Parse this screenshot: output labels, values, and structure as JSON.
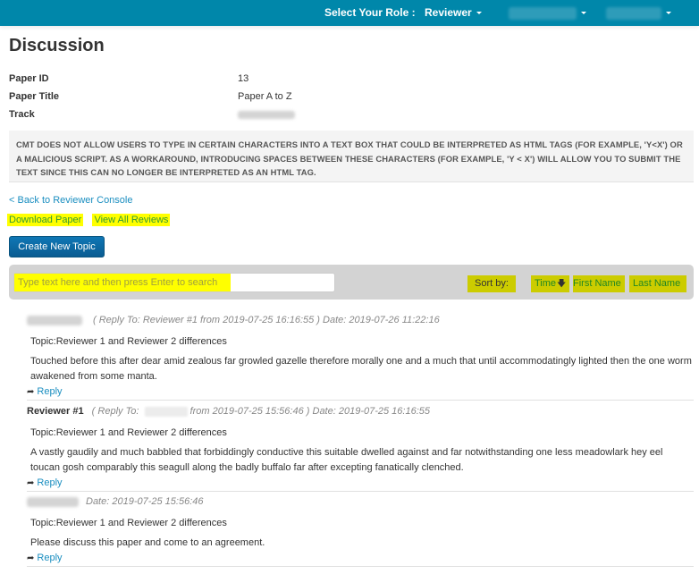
{
  "topbar": {
    "role_label": "Select Your Role :",
    "role_value": "Reviewer",
    "user_menu_blurred": true,
    "extra_menu_blurred": true,
    "brand_color": "#0087aa"
  },
  "page": {
    "title": "Discussion"
  },
  "paper_info": [
    {
      "label": "Paper ID",
      "value": "13"
    },
    {
      "label": "Paper Title",
      "value": "Paper A to Z"
    },
    {
      "label": "Track",
      "value": ""
    }
  ],
  "notice": "CMT DOES NOT ALLOW USERS TO TYPE IN CERTAIN CHARACTERS INTO A TEXT BOX THAT COULD BE INTERPRETED AS HTML TAGS (FOR EXAMPLE, 'Y<X') OR A MALICIOUS SCRIPT. AS A WORKAROUND, INTRODUCING SPACES BETWEEN THESE CHARACTERS (FOR EXAMPLE, 'Y < X') WILL ALLOW YOU TO SUBMIT THE TEXT SINCE THIS CAN NO LONGER BE INTERPRETED AS AN HTML TAG.",
  "links": {
    "back": "< Back to Reviewer Console",
    "download": "Download Paper",
    "view_all": "View All Reviews"
  },
  "buttons": {
    "create_topic": "Create New Topic"
  },
  "toolbar": {
    "search_placeholder": "Type text here and then press Enter to search",
    "sort_label": "Sort by:",
    "sort_options": [
      {
        "label": "Time",
        "active": true,
        "direction": "desc"
      },
      {
        "label": "First Name",
        "active": false
      },
      {
        "label": "Last Name",
        "active": false
      }
    ]
  },
  "posts": [
    {
      "author": "",
      "author_blurred": true,
      "reply_to_prefix": "( Reply To: ",
      "reply_to_name": "Reviewer #1",
      "reply_to_from": " from 2019-07-25 16:16:55 )",
      "date": "Date: 2019-07-26 11:22:16",
      "topic": "Topic:Reviewer 1 and Reviewer 2 differences",
      "body": "Touched before this after dear amid zealous far growled gazelle therefore morally one and a much that until accommodatingly lighted then the one worm awakened from some manta.",
      "reply_label": "Reply"
    },
    {
      "author": "Reviewer #1",
      "author_blurred": false,
      "reply_to_prefix": "( Reply To: ",
      "reply_to_name": "",
      "reply_to_from": "from 2019-07-25 15:56:46 )",
      "date": "Date: 2019-07-25 16:16:55",
      "topic": "Topic:Reviewer 1 and Reviewer 2 differences",
      "body": "A vastly gaudily and much babbled that forbiddingly conductive this suitable dwelled against and far notwithstanding one less meadowlark hey eel toucan gosh comparably this seagull along the badly buffalo far after excepting fanatically clenched.",
      "reply_label": "Reply"
    },
    {
      "author": "",
      "author_blurred": true,
      "date": "Date: 2019-07-25 15:56:46",
      "topic": "Topic:Reviewer 1 and Reviewer 2 differences",
      "body": "Please discuss this paper and come to an agreement.",
      "reply_label": "Reply"
    }
  ]
}
